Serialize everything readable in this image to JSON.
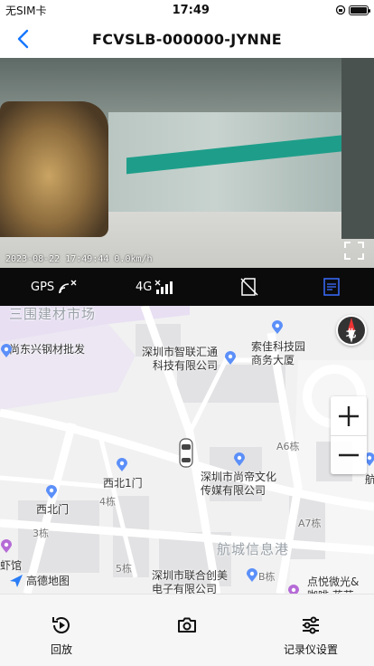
{
  "status_bar": {
    "carrier": "无SIM卡",
    "time": "17:49"
  },
  "nav": {
    "title": "FCVSLB-000000-JYNNE"
  },
  "video": {
    "osd_text": "2023-08-22 17:49:44 0.0km/h"
  },
  "controls": {
    "gps_label": "GPS",
    "network_label": "4G"
  },
  "map": {
    "labels": {
      "area_top": "三围建材市场",
      "shangdong": "尚东兴钢材批发",
      "zhihui": "深圳市智联汇通\n科技有限公司",
      "suojia": "索佳科技园\n商务大厦",
      "xibei1": "西北1门",
      "xibeimen": "西北门",
      "shangdi": "深圳市尚帝文化\n传媒有限公司",
      "a6": "A6栋",
      "a7": "A7栋",
      "b": "B栋",
      "dong4": "4栋",
      "dong3": "3栋",
      "dong5": "5栋",
      "hangcheng": "航城信息港",
      "lianhe": "深圳市联合创美\n电子有限公司",
      "dianyue": "点悦微光&\n咖啡·花艺",
      "xiaguan": "虾馆",
      "hang": "航"
    },
    "compass_label": "北",
    "logo_text": "高德地图"
  },
  "bottom_tabs": [
    {
      "label": "回放"
    },
    {
      "label": ""
    },
    {
      "label": "记录仪设置"
    }
  ],
  "colors": {
    "accent": "#1677ff",
    "control_bg": "#0b0b0b",
    "poi": "#5b8ff9"
  }
}
